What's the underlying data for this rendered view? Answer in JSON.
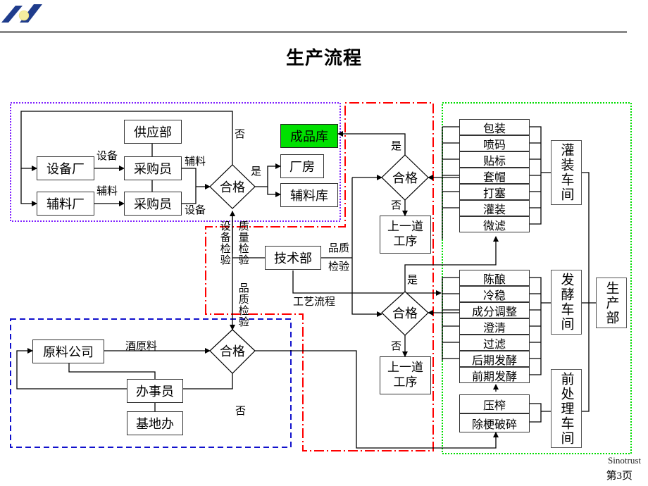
{
  "header": {
    "logo": "sinotrust-logo-icon",
    "title": "生产流程"
  },
  "colors": {
    "purchase_group_border": "#7f20ff",
    "qc_group_border": "#ff0000",
    "production_group_border": "#00dd00",
    "raw_group_border": "#1010cc",
    "finished_store_fill": "#00e000"
  },
  "purchase": {
    "supply_dept": "供应部",
    "equipment_factory": "设备厂",
    "aux_factory": "辅料厂",
    "buyer_top": "采购员",
    "buyer_bottom": "采购员",
    "edge_equipment_in": "设备",
    "edge_aux_in": "辅料",
    "edge_aux_out": "辅料",
    "edge_equipment_out": "设备",
    "decision": "合格",
    "yes": "是",
    "no": "否",
    "plant": "厂房",
    "aux_store": "辅料库",
    "finished_store": "成品库"
  },
  "tech": {
    "dept": "技术部",
    "equipment_check": "设备检验",
    "quality_check": "质量检验",
    "product_quality_check": "品质检验",
    "quality_check_right_1": "品质",
    "quality_check_right_2": "检验",
    "process_flow": "工艺流程"
  },
  "qc": {
    "top_decision": "合格",
    "top_yes": "是",
    "top_no": "否",
    "top_prev_step_1": "上一道",
    "top_prev_step_2": "工序",
    "mid_decision": "合格",
    "mid_yes": "是",
    "mid_no": "否",
    "mid_prev_step_1": "上一道",
    "mid_prev_step_2": "工序"
  },
  "raw": {
    "company": "原料公司",
    "wine_material": "酒原料",
    "decision": "合格",
    "clerk": "办事员",
    "base_office": "基地办",
    "no": "否"
  },
  "production": {
    "filling_steps": [
      "包装",
      "喷码",
      "贴标",
      "套帽",
      "打塞",
      "灌装",
      "微滤"
    ],
    "filling_workshop": "灌装车间",
    "fermentation_steps": [
      "陈酿",
      "冷稳",
      "成分调整",
      "澄清",
      "过滤",
      "后期发酵",
      "前期发酵"
    ],
    "fermentation_workshop": "发酵车间",
    "pretreatment_steps": [
      "压榨",
      "除梗破碎"
    ],
    "pretreatment_workshop": "前处理车间",
    "production_dept": "生产部"
  },
  "footer": {
    "brand": "Sinotrust",
    "page": "第3页"
  }
}
